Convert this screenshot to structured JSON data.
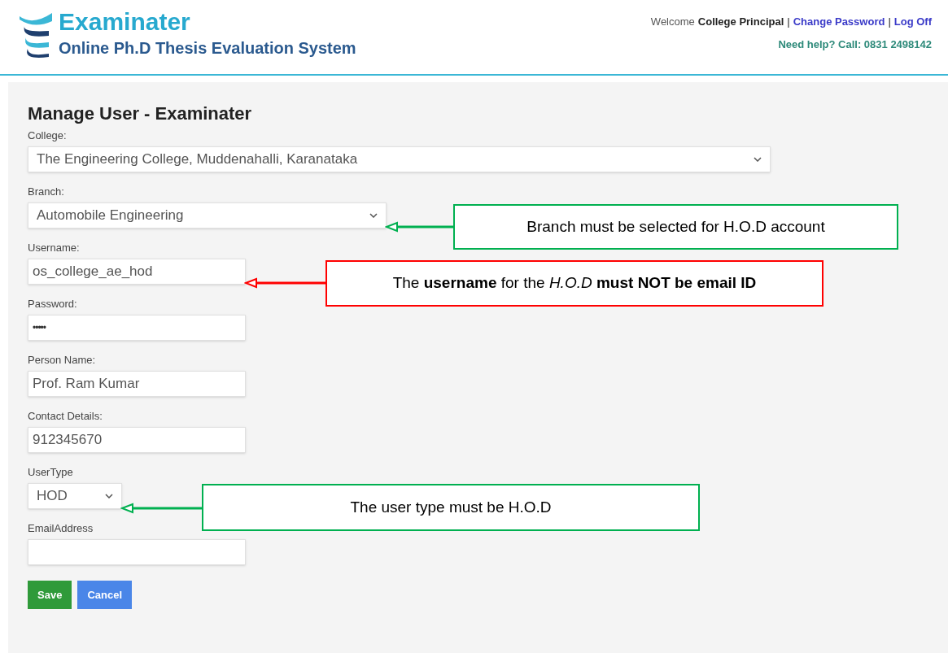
{
  "header": {
    "app_name": "Examinater",
    "subtitle": "Online Ph.D Thesis Evaluation System",
    "welcome": "Welcome",
    "user": "College Principal",
    "separator_1": "|",
    "change_password": "Change Password",
    "separator_2": "|",
    "log_off": "Log Off",
    "help": "Need help? Call: 0831 2498142"
  },
  "form": {
    "title": "Manage User - Examinater",
    "fields": [
      {
        "kind": "select",
        "label": "College:",
        "value": "The Engineering College, Muddenahalli, Karanataka"
      },
      {
        "kind": "select",
        "label": "Branch:",
        "value": "Automobile Engineering"
      },
      {
        "kind": "text",
        "label": "Username:",
        "value": "os_college_ae_hod"
      },
      {
        "kind": "password",
        "label": "Password:",
        "value": "•••••"
      },
      {
        "kind": "text",
        "label": "Person Name:",
        "value": "Prof. Ram Kumar"
      },
      {
        "kind": "text",
        "label": "Contact Details:",
        "value": "912345670"
      },
      {
        "kind": "select",
        "label": "UserType",
        "value": "HOD"
      },
      {
        "kind": "text",
        "label": "EmailAddress"
      }
    ],
    "buttons": [
      {
        "kind": "save",
        "label": "Save"
      },
      {
        "kind": "cancel",
        "label": "Cancel"
      }
    ]
  },
  "callouts": [
    {
      "text": "Branch must be selected for H.O.D account",
      "color": "#00b050"
    },
    {
      "text": "The **username** for the *H.O.D* **must NOT be email ID**",
      "color": "#ff0000"
    },
    {
      "text": "The user type must be H.O.D",
      "color": "#00b050"
    }
  ]
}
